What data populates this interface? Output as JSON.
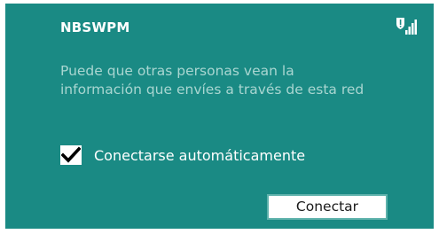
{
  "network": {
    "name": "NBSWPM",
    "signal_icon": "wifi-signal-warning-icon",
    "warning_text": "Puede que otras personas vean la información que envíes a través de esta red"
  },
  "auto_connect": {
    "label": "Conectarse automáticamente",
    "checked": true
  },
  "actions": {
    "connect_label": "Conectar"
  },
  "colors": {
    "panel_background": "#1a8a84",
    "warning_text": "#a9d6d1",
    "primary_text": "#ffffff",
    "button_border": "#5fb2ac"
  }
}
